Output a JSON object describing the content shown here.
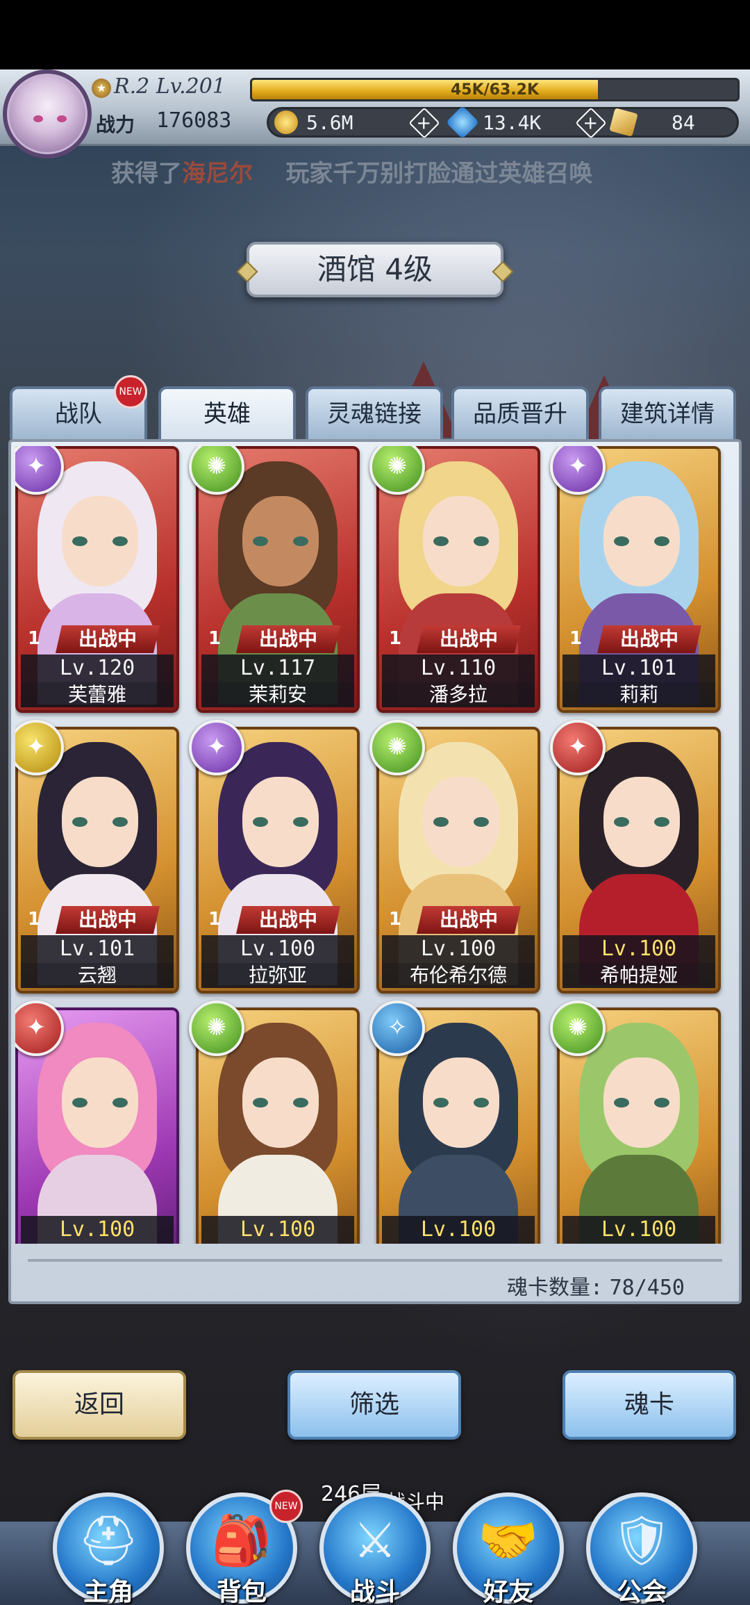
{
  "header": {
    "rank": "R.2",
    "level": "Lv.201",
    "xp_text": "45K/63.2K",
    "xp_fraction": 0.712,
    "power_label": "战力",
    "power_value": "176083",
    "resources": [
      {
        "name": "gold",
        "icon": "gold-coin-icon",
        "value": "5.6M",
        "color": "#e0a919"
      },
      {
        "name": "diamond",
        "icon": "blue-gem-icon",
        "value": "13.4K",
        "color": "#2a8ee8"
      },
      {
        "name": "card",
        "icon": "gold-card-icon",
        "value": "84",
        "color": "#e6b84a"
      }
    ]
  },
  "ticker": {
    "part1": "获得了",
    "highlight": "海尼尔",
    "part2": "玩家千万别打脸通过英雄召唤"
  },
  "title": "酒馆 4级",
  "tabs": [
    {
      "label": "战队",
      "new": "NEW"
    },
    {
      "label": "英雄"
    },
    {
      "label": "灵魂链接"
    },
    {
      "label": "品质晋升"
    },
    {
      "label": "建筑详情"
    }
  ],
  "deploy_label": "出战中",
  "heroes": [
    {
      "name": "芙蕾雅",
      "level": "Lv.120",
      "element": "purple",
      "deploy_num": "1",
      "frame": "red"
    },
    {
      "name": "茉莉安",
      "level": "Lv.117",
      "element": "green",
      "deploy_num": "1",
      "frame": "red"
    },
    {
      "name": "潘多拉",
      "level": "Lv.110",
      "element": "green",
      "deploy_num": "1",
      "frame": "red"
    },
    {
      "name": "莉莉",
      "level": "Lv.101",
      "element": "purple",
      "deploy_num": "1",
      "frame": "gold"
    },
    {
      "name": "云翘",
      "level": "Lv.101",
      "element": "yellow",
      "deploy_num": "1",
      "frame": "gold"
    },
    {
      "name": "拉弥亚",
      "level": "Lv.100",
      "element": "purple",
      "deploy_num": "1",
      "frame": "gold"
    },
    {
      "name": "布伦希尔德",
      "level": "Lv.100",
      "element": "green",
      "deploy_num": "1",
      "frame": "gold"
    },
    {
      "name": "希帕提娅",
      "level": "Lv.100",
      "element": "red",
      "frame": "gold"
    },
    {
      "name": "",
      "level": "Lv.100",
      "element": "red",
      "frame": "purple"
    },
    {
      "name": "",
      "level": "Lv.100",
      "element": "green",
      "frame": "gold"
    },
    {
      "name": "",
      "level": "Lv.100",
      "element": "blue",
      "frame": "gold"
    },
    {
      "name": "",
      "level": "Lv.100",
      "element": "green",
      "frame": "gold"
    }
  ],
  "soul_card_count": {
    "label": "魂卡数量:",
    "value": "78/450"
  },
  "buttons": {
    "back": "返回",
    "filter": "筛选",
    "soul_card": "魂卡"
  },
  "battle": {
    "floor": "246",
    "floor_unit": "层",
    "status": "战斗中"
  },
  "nav": [
    {
      "label": "主角",
      "icon": "helmet-icon"
    },
    {
      "label": "背包",
      "icon": "backpack-icon",
      "new": "NEW"
    },
    {
      "label": "战斗",
      "icon": "crossed-swords-icon"
    },
    {
      "label": "好友",
      "icon": "handshake-icon"
    },
    {
      "label": "公会",
      "icon": "guild-shield-icon"
    }
  ]
}
